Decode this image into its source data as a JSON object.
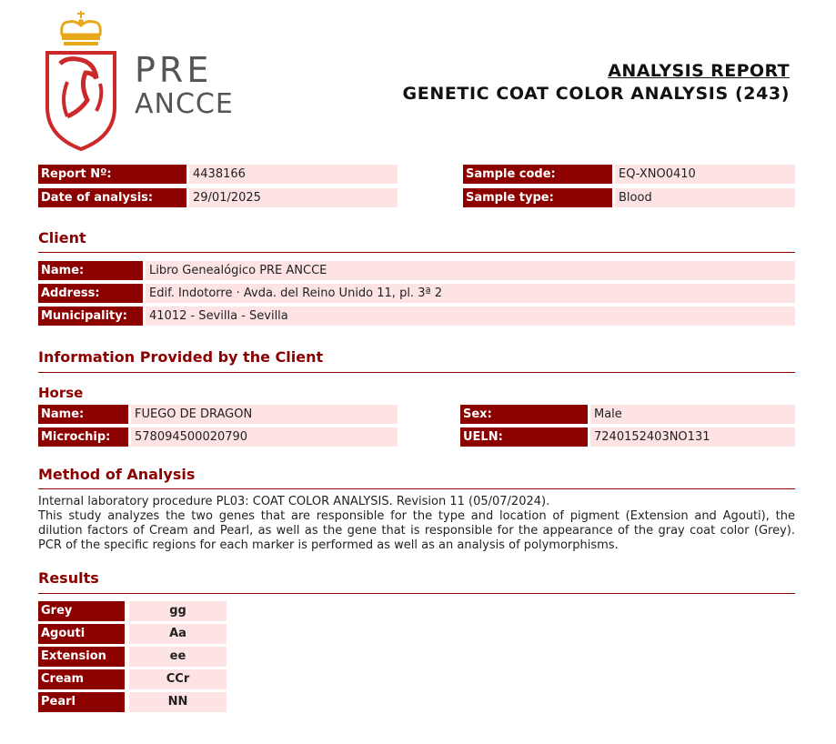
{
  "brand": {
    "line1": "PRE",
    "line2": "ANCCE",
    "crown_color": "#e8a81c",
    "shield_color": "#cc2a2a"
  },
  "title": {
    "line1": "ANALYSIS REPORT",
    "line2": "GENETIC COAT COLOR ANALYSIS (243)"
  },
  "report": {
    "number_label": "Report Nº:",
    "number": "4438166",
    "date_label": "Date of analysis:",
    "date": "29/01/2025",
    "sample_code_label": "Sample code:",
    "sample_code": "EQ-XNO0410",
    "sample_type_label": "Sample type:",
    "sample_type": "Blood"
  },
  "client": {
    "title": "Client",
    "name_label": "Name:",
    "name": "Libro Genealógico PRE ANCCE",
    "address_label": "Address:",
    "address": "Edif. Indotorre · Avda. del Reino Unido 11, pl. 3ª  2",
    "municipality_label": "Municipality:",
    "municipality": "41012 - Sevilla - Sevilla"
  },
  "info": {
    "title": "Information Provided by the Client",
    "horse_title": "Horse",
    "name_label": "Name:",
    "name": "FUEGO DE DRAGON",
    "microchip_label": "Microchip:",
    "microchip": "578094500020790",
    "sex_label": "Sex:",
    "sex": "Male",
    "ueln_label": "UELN:",
    "ueln": "7240152403NO131"
  },
  "method": {
    "title": "Method of Analysis",
    "line1": "Internal laboratory procedure PL03: COAT COLOR ANALYSIS. Revision 11 (05/07/2024).",
    "line2": "This study analyzes the two genes that are responsible for the type and location of pigment (Extension and Agouti), the dilution factors of Cream and Pearl, as well as the gene that is responsible for the appearance of the gray coat color (Grey). PCR of the specific regions for each marker is performed as well as an analysis of polymorphisms."
  },
  "results": {
    "title": "Results",
    "rows": [
      {
        "label": "Grey",
        "value": "gg"
      },
      {
        "label": "Agouti",
        "value": "Aa"
      },
      {
        "label": "Extension",
        "value": "ee"
      },
      {
        "label": "Cream",
        "value": "CCr"
      },
      {
        "label": "Pearl",
        "value": "NN"
      }
    ]
  },
  "colors": {
    "label_bg": "#8c0000",
    "value_bg": "#fde3e3",
    "heading": "#8c0000"
  }
}
